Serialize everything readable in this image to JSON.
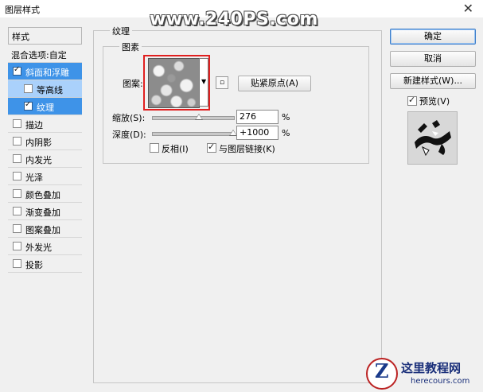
{
  "window": {
    "title": "图层样式",
    "close_glyph": "✕"
  },
  "watermark_top": "www.240PS.com",
  "left_list": {
    "header": "样式",
    "blend_options": "混合选项:自定",
    "items": [
      {
        "label": "斜面和浮雕",
        "checked": true
      },
      {
        "label": "等高线",
        "checked": false
      },
      {
        "label": "纹理",
        "checked": true
      },
      {
        "label": "描边",
        "checked": false
      },
      {
        "label": "内阴影",
        "checked": false
      },
      {
        "label": "内发光",
        "checked": false
      },
      {
        "label": "光泽",
        "checked": false
      },
      {
        "label": "颜色叠加",
        "checked": false
      },
      {
        "label": "渐变叠加",
        "checked": false
      },
      {
        "label": "图案叠加",
        "checked": false
      },
      {
        "label": "外发光",
        "checked": false
      },
      {
        "label": "投影",
        "checked": false
      }
    ]
  },
  "texture": {
    "section_title": "纹理",
    "group_title": "图素",
    "pattern_label": "图案:",
    "snap_button": "贴紧原点(A)",
    "scale_label": "缩放(S):",
    "scale_value": "276",
    "scale_unit": "%",
    "depth_label": "深度(D):",
    "depth_value": "+1000",
    "depth_unit": "%",
    "invert_label": "反相(I)",
    "invert_checked": false,
    "link_label": "与图层链接(K)",
    "link_checked": true,
    "scale_fraction": 0.276,
    "depth_fraction": 1.0
  },
  "right_buttons": {
    "ok": "确定",
    "cancel": "取消",
    "new_style": "新建样式(W)...",
    "preview_label": "预览(V)",
    "preview_checked": true
  },
  "logo": {
    "main": "这里教程网",
    "sub": "herecours.com",
    "glyph": "Z"
  },
  "colors": {
    "selection": "#3e93e8",
    "sub_selection": "#aad1fb",
    "highlight_box": "#e02020"
  }
}
